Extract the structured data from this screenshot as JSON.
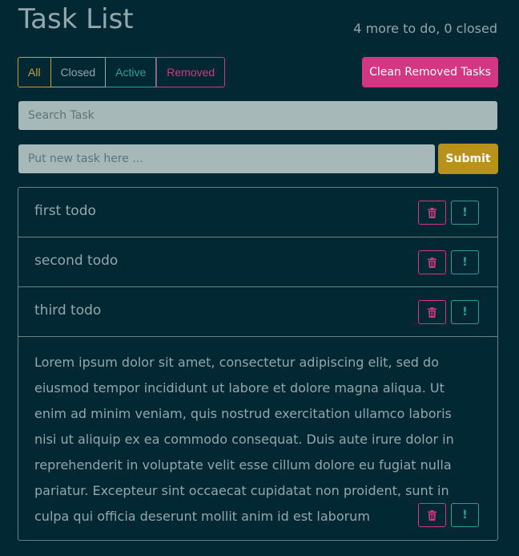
{
  "header": {
    "title": "Task List",
    "summary": "4 more to do, 0 closed"
  },
  "filters": {
    "all": "All",
    "closed": "Closed",
    "active": "Active",
    "removed": "Removed"
  },
  "clean_button": "Clean Removed Tasks",
  "search": {
    "placeholder": "Search Task"
  },
  "new_task": {
    "placeholder": "Put new task here ...",
    "submit": "Submit"
  },
  "tasks": [
    {
      "text": "first todo"
    },
    {
      "text": "second todo"
    },
    {
      "text": "third todo"
    },
    {
      "text": "Lorem ipsum dolor sit amet, consectetur adipiscing elit, sed do eiusmod tempor incididunt ut labore et dolore magna aliqua. Ut enim ad minim veniam, quis nostrud exercitation ullamco laboris nisi ut aliquip ex ea commodo consequat. Duis aute irure dolor in reprehenderit in voluptate velit esse cillum dolore eu fugiat nulla pariatur. Excepteur sint occaecat cupidatat non proident, sunt in culpa qui officia deserunt mollit anim id est laborum"
    }
  ],
  "icons": {
    "delete": "trash-icon",
    "flag": "exclamation-icon"
  },
  "colors": {
    "background": "#022833",
    "yellow": "#c6a12c",
    "magenta": "#d33682",
    "cyan": "#2aa198",
    "muted": "#93a7ac"
  }
}
